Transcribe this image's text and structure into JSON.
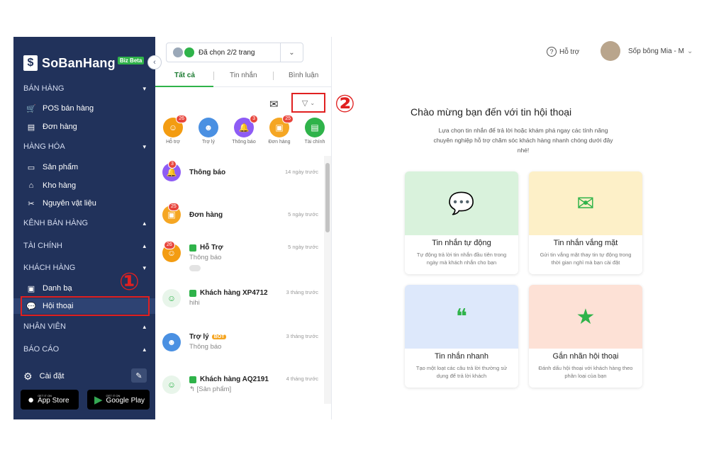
{
  "brand": {
    "logo": "$",
    "name": "SoBanHang",
    "badge": "Biz Beta"
  },
  "sidebar": {
    "sections": [
      {
        "label": "BÁN HÀNG",
        "chev": "⌄"
      },
      {
        "label": "HÀNG HÓA",
        "chev": "⌄"
      },
      {
        "label": "KÊNH BÁN HÀNG",
        "chev": "⌃"
      },
      {
        "label": "TÀI CHÍNH",
        "chev": "⌃"
      },
      {
        "label": "KHÁCH HÀNG",
        "chev": "⌄"
      },
      {
        "label": "NHÂN VIÊN",
        "chev": "⌃"
      },
      {
        "label": "BÁO CÁO",
        "chev": "⌃"
      }
    ],
    "items": [
      {
        "label": "POS bán hàng",
        "icon": "cart-icon"
      },
      {
        "label": "Đơn hàng",
        "icon": "document-icon"
      },
      {
        "label": "Sản phẩm",
        "icon": "box-icon"
      },
      {
        "label": "Kho hàng",
        "icon": "warehouse-icon"
      },
      {
        "label": "Nguyên vật liệu",
        "icon": "tools-icon"
      },
      {
        "label": "Danh bạ",
        "icon": "contact-book-icon"
      },
      {
        "label": "Hội thoại",
        "icon": "chat-bubble-icon"
      }
    ],
    "settings": "Cài đặt",
    "app_store": {
      "small": "GET IT ON",
      "big": "App Store"
    },
    "google_play": {
      "small": "GET IT ON",
      "big": "Google Play"
    }
  },
  "annotations": {
    "one": "①",
    "two": "②"
  },
  "page_select": {
    "label": "Đã chọn 2/2 trang"
  },
  "tabs": [
    "Tất cả",
    "Tin nhắn",
    "Bình luận"
  ],
  "categories": [
    {
      "label": "Hỗ trợ",
      "badge": "26",
      "color": "#f39c12"
    },
    {
      "label": "Trợ lý",
      "badge": "",
      "color": "#4a90e2"
    },
    {
      "label": "Thông báo",
      "badge": "3",
      "color": "#8e5cf5"
    },
    {
      "label": "Đơn hàng",
      "badge": "25",
      "color": "#f5a623"
    },
    {
      "label": "Tài chính",
      "badge": "",
      "color": "#2fb34a"
    }
  ],
  "conversations": [
    {
      "name": "Thông báo",
      "time": "14 ngày trước",
      "sub": "",
      "badge": "3"
    },
    {
      "name": "Đơn hàng",
      "time": "5 ngày trước",
      "sub": "",
      "badge": "25"
    },
    {
      "name": "Hỗ Trợ",
      "time": "5 ngày trước",
      "sub": "Thông báo",
      "badge": "26"
    },
    {
      "name": "Khách hàng XP4712",
      "time": "3 tháng trước",
      "sub": "hihi",
      "badge": ""
    },
    {
      "name": "Trợ lý",
      "time": "3 tháng trước",
      "sub": "Thông báo",
      "badge": "",
      "tag": "BOT"
    },
    {
      "name": "Khách hàng AQ2191",
      "time": "4 tháng trước",
      "sub": "↰ [Sản phẩm]",
      "badge": ""
    }
  ],
  "topbar": {
    "help": "Hỗ trợ",
    "user": "Sốp bông Mia - M"
  },
  "welcome": {
    "title": "Chào mừng bạn đến với tin hội thoại",
    "desc": "Lựa chọn tin nhắn để trả lời hoặc khám phá ngay các tính năng chuyên nghiệp hỗ trợ chăm sóc khách hàng nhanh chóng dưới đây nhé!"
  },
  "cards": [
    {
      "title": "Tin nhắn tự động",
      "desc": "Tự động trả lời tin nhắn đầu tiên trong ngày mà khách nhắn cho bạn",
      "bg": "#d9f2dc"
    },
    {
      "title": "Tin nhắn vắng mặt",
      "desc": "Gửi tin vắng mặt thay tin tự động trong thời gian nghỉ mà bạn cài đặt",
      "bg": "#fdf0c8"
    },
    {
      "title": "Tin nhắn nhanh",
      "desc": "Tạo một loạt các câu trả lời thường sử dụng để trả lời khách",
      "bg": "#dde8fb"
    },
    {
      "title": "Gắn nhãn hội thoại",
      "desc": "Đánh dấu hội thoại với khách hàng theo phân loại của bạn",
      "bg": "#fde1d6"
    }
  ]
}
